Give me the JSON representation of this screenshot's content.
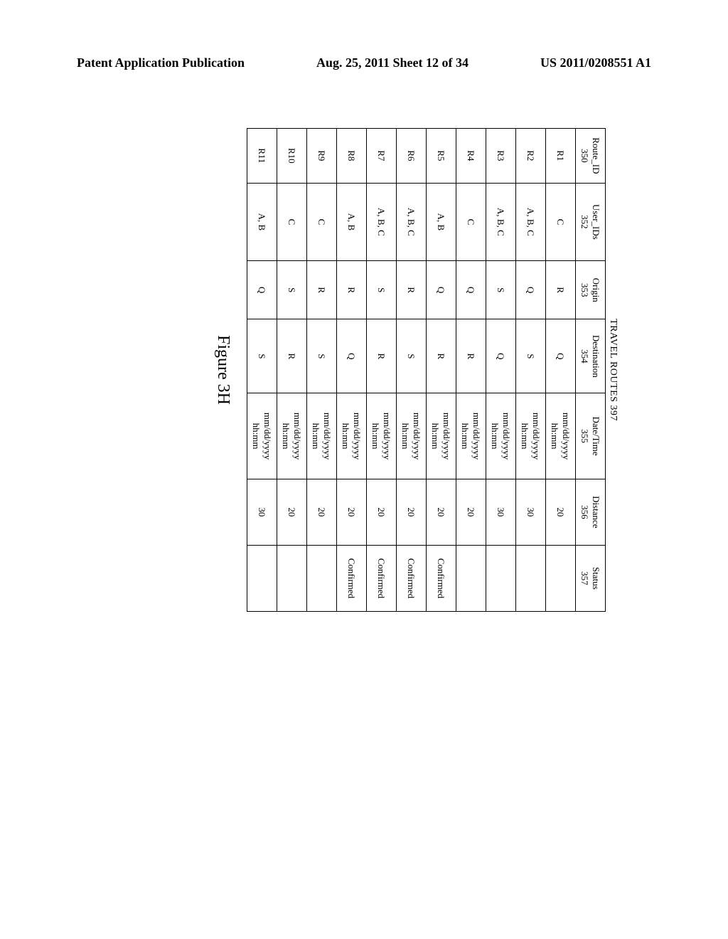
{
  "header": {
    "left": "Patent Application Publication",
    "center": "Aug. 25, 2011  Sheet 12 of 34",
    "right": "US 2011/0208551 A1"
  },
  "table": {
    "title": "TRAVEL ROUTES 397",
    "columns": [
      {
        "label": "Route_ID",
        "num": "350"
      },
      {
        "label": "User_IDs",
        "num": "352"
      },
      {
        "label": "Origin",
        "num": "353"
      },
      {
        "label": "Destination",
        "num": "354"
      },
      {
        "label": "Date/Time",
        "num": "355"
      },
      {
        "label": "Distance",
        "num": "356"
      },
      {
        "label": "Status",
        "num": "357"
      }
    ],
    "rows": [
      {
        "route_id": "R1",
        "user_ids": "C",
        "origin": "R",
        "destination": "Q",
        "datetime": "mm/dd/yyyy\nhh:mm",
        "distance": "20",
        "status": ""
      },
      {
        "route_id": "R2",
        "user_ids": "A, B, C",
        "origin": "Q",
        "destination": "S",
        "datetime": "mm/dd/yyyy\nhh:mm",
        "distance": "30",
        "status": ""
      },
      {
        "route_id": "R3",
        "user_ids": "A, B, C",
        "origin": "S",
        "destination": "Q",
        "datetime": "mm/dd/yyyy\nhh:mm",
        "distance": "30",
        "status": ""
      },
      {
        "route_id": "R4",
        "user_ids": "C",
        "origin": "Q",
        "destination": "R",
        "datetime": "mm/dd/yyyy\nhh:mm",
        "distance": "20",
        "status": ""
      },
      {
        "route_id": "R5",
        "user_ids": "A, B",
        "origin": "Q",
        "destination": "R",
        "datetime": "mm/dd/yyyy\nhh:mm",
        "distance": "20",
        "status": "Confirmed"
      },
      {
        "route_id": "R6",
        "user_ids": "A, B, C",
        "origin": "R",
        "destination": "S",
        "datetime": "mm/dd/yyyy\nhh:mm",
        "distance": "20",
        "status": "Confirmed"
      },
      {
        "route_id": "R7",
        "user_ids": "A, B, C",
        "origin": "S",
        "destination": "R",
        "datetime": "mm/dd/yyyy\nhh:mm",
        "distance": "20",
        "status": "Confirmed"
      },
      {
        "route_id": "R8",
        "user_ids": "A, B",
        "origin": "R",
        "destination": "Q",
        "datetime": "mm/dd/yyyy\nhh:mm",
        "distance": "20",
        "status": "Confirmed"
      },
      {
        "route_id": "R9",
        "user_ids": "C",
        "origin": "R",
        "destination": "S",
        "datetime": "mm/dd/yyyy\nhh:mm",
        "distance": "20",
        "status": ""
      },
      {
        "route_id": "R10",
        "user_ids": "C",
        "origin": "S",
        "destination": "R",
        "datetime": "mm/dd/yyyy\nhh:mm",
        "distance": "20",
        "status": ""
      },
      {
        "route_id": "R11",
        "user_ids": "A, B",
        "origin": "Q",
        "destination": "S",
        "datetime": "mm/dd/yyyy\nhh:mm",
        "distance": "30",
        "status": ""
      }
    ]
  },
  "figure_caption": "Figure 3H"
}
